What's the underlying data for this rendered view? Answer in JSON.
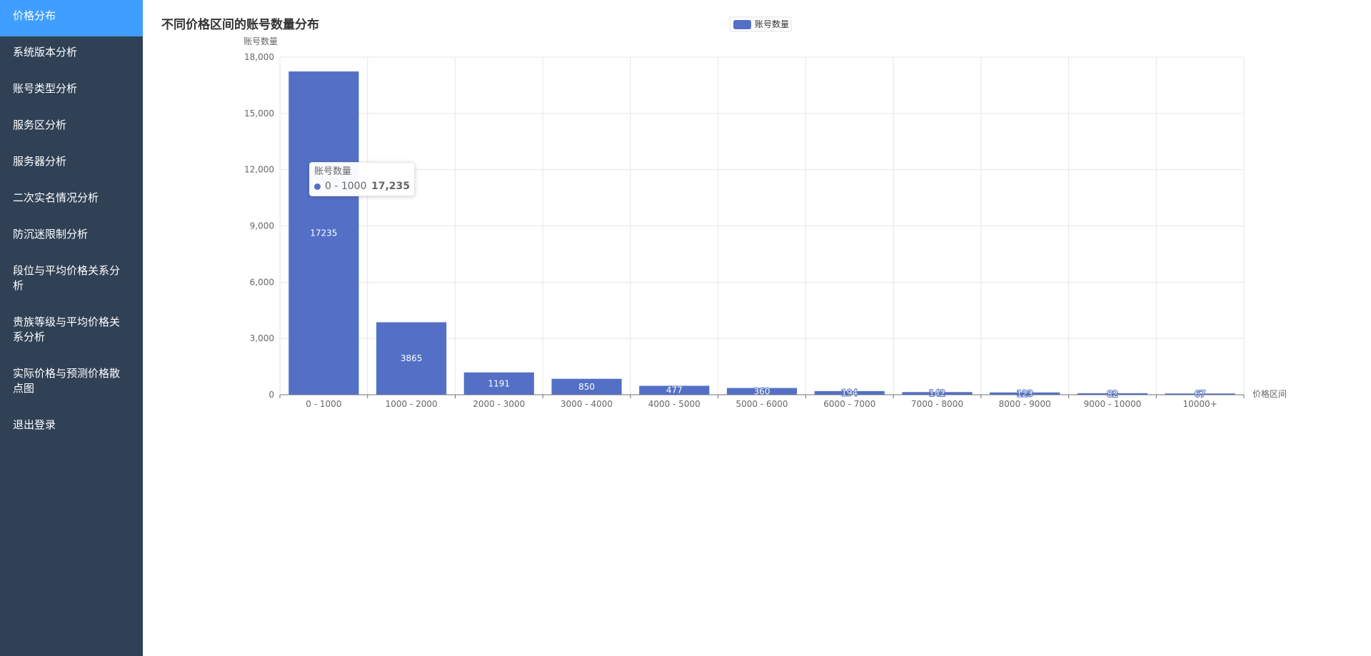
{
  "sidebar": {
    "items": [
      {
        "label": "价格分布",
        "active": true
      },
      {
        "label": "系统版本分析",
        "active": false
      },
      {
        "label": "账号类型分析",
        "active": false
      },
      {
        "label": "服务区分析",
        "active": false
      },
      {
        "label": "服务器分析",
        "active": false
      },
      {
        "label": "二次实名情况分析",
        "active": false
      },
      {
        "label": "防沉迷限制分析",
        "active": false
      },
      {
        "label": "段位与平均价格关系分析",
        "active": false
      },
      {
        "label": "贵族等级与平均价格关系分析",
        "active": false
      },
      {
        "label": "实际价格与预测价格散点图",
        "active": false
      },
      {
        "label": "退出登录",
        "active": false
      }
    ]
  },
  "colors": {
    "sidebar_bg": "#304156",
    "active_bg": "#409eff",
    "bar": "#5470c6"
  },
  "tooltip": {
    "series": "账号数量",
    "category": "0 - 1000",
    "value": "17,235"
  },
  "chart_data": {
    "type": "bar",
    "title": "不同价格区间的账号数量分布",
    "xlabel": "价格区间",
    "ylabel": "账号数量",
    "legend": {
      "entries": [
        "账号数量"
      ],
      "position": "top-center"
    },
    "categories": [
      "0 - 1000",
      "1000 - 2000",
      "2000 - 3000",
      "3000 - 4000",
      "4000 - 5000",
      "5000 - 6000",
      "6000 - 7000",
      "7000 - 8000",
      "8000 - 9000",
      "9000 - 10000",
      "10000+"
    ],
    "series": [
      {
        "name": "账号数量",
        "values": [
          17235,
          3865,
          1191,
          850,
          477,
          360,
          194,
          142,
          123,
          82,
          67
        ]
      }
    ],
    "data_labels": [
      "17235",
      "3865",
      "1191",
      "850",
      "477",
      "360",
      "194",
      "142",
      "123",
      "82",
      "67"
    ],
    "ylim": [
      0,
      18000
    ],
    "yticks": [
      0,
      3000,
      6000,
      9000,
      12000,
      15000,
      18000
    ],
    "ytick_labels": [
      "0",
      "3,000",
      "6,000",
      "9,000",
      "12,000",
      "15,000",
      "18,000"
    ],
    "grid": true
  }
}
